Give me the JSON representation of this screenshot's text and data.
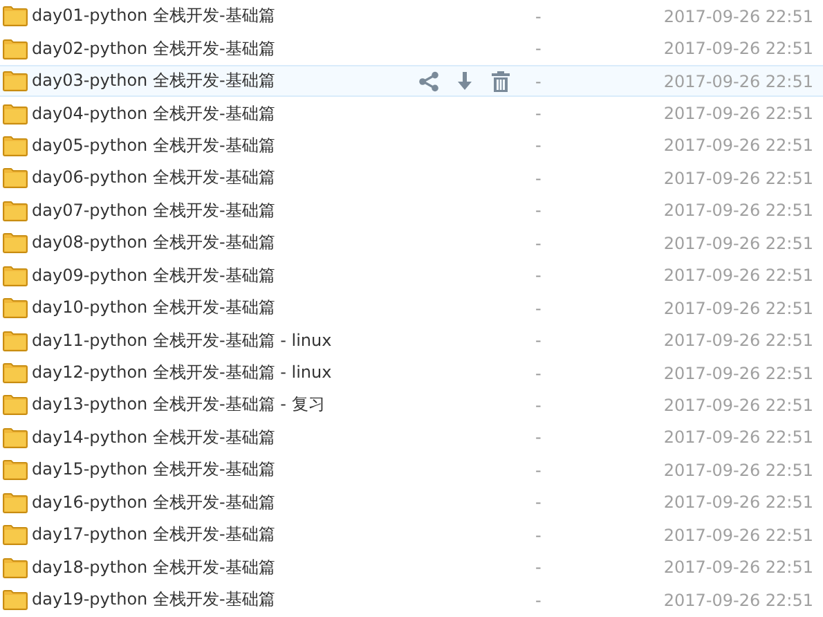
{
  "files": [
    {
      "name": "day01-python 全栈开发-基础篇",
      "size": "-",
      "modified": "2017-09-26 22:51",
      "hovered": false
    },
    {
      "name": "day02-python 全栈开发-基础篇",
      "size": "-",
      "modified": "2017-09-26 22:51",
      "hovered": false
    },
    {
      "name": "day03-python 全栈开发-基础篇",
      "size": "-",
      "modified": "2017-09-26 22:51",
      "hovered": true
    },
    {
      "name": "day04-python 全栈开发-基础篇",
      "size": "-",
      "modified": "2017-09-26 22:51",
      "hovered": false
    },
    {
      "name": "day05-python 全栈开发-基础篇",
      "size": "-",
      "modified": "2017-09-26 22:51",
      "hovered": false
    },
    {
      "name": "day06-python 全栈开发-基础篇",
      "size": "-",
      "modified": "2017-09-26 22:51",
      "hovered": false
    },
    {
      "name": "day07-python 全栈开发-基础篇",
      "size": "-",
      "modified": "2017-09-26 22:51",
      "hovered": false
    },
    {
      "name": "day08-python 全栈开发-基础篇",
      "size": "-",
      "modified": "2017-09-26 22:51",
      "hovered": false
    },
    {
      "name": "day09-python 全栈开发-基础篇",
      "size": "-",
      "modified": "2017-09-26 22:51",
      "hovered": false
    },
    {
      "name": "day10-python 全栈开发-基础篇",
      "size": "-",
      "modified": "2017-09-26 22:51",
      "hovered": false
    },
    {
      "name": "day11-python 全栈开发-基础篇 - linux",
      "size": "-",
      "modified": "2017-09-26 22:51",
      "hovered": false
    },
    {
      "name": "day12-python 全栈开发-基础篇 - linux",
      "size": "-",
      "modified": "2017-09-26 22:51",
      "hovered": false
    },
    {
      "name": "day13-python 全栈开发-基础篇 - 复习",
      "size": "-",
      "modified": "2017-09-26 22:51",
      "hovered": false
    },
    {
      "name": "day14-python 全栈开发-基础篇",
      "size": "-",
      "modified": "2017-09-26 22:51",
      "hovered": false
    },
    {
      "name": "day15-python 全栈开发-基础篇",
      "size": "-",
      "modified": "2017-09-26 22:51",
      "hovered": false
    },
    {
      "name": "day16-python 全栈开发-基础篇",
      "size": "-",
      "modified": "2017-09-26 22:51",
      "hovered": false
    },
    {
      "name": "day17-python 全栈开发-基础篇",
      "size": "-",
      "modified": "2017-09-26 22:51",
      "hovered": false
    },
    {
      "name": "day18-python 全栈开发-基础篇",
      "size": "-",
      "modified": "2017-09-26 22:51",
      "hovered": false
    },
    {
      "name": "day19-python 全栈开发-基础篇",
      "size": "-",
      "modified": "2017-09-26 22:51",
      "hovered": false
    }
  ]
}
